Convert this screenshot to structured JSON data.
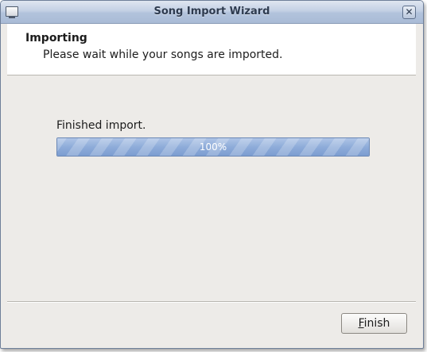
{
  "window": {
    "title": "Song Import Wizard",
    "close_symbol": "✕",
    "icon": "window-icon"
  },
  "header": {
    "title": "Importing",
    "subtitle": "Please wait while your songs are imported."
  },
  "progress": {
    "status": "Finished import.",
    "value": 1.0,
    "label": "100%"
  },
  "buttons": {
    "finish": {
      "mnemonic": "F",
      "rest": "inish"
    }
  },
  "colors": {
    "titlebar": "#b8c7de",
    "progress_fill": "#8eacd9",
    "dialog_bg": "#edebe8"
  }
}
